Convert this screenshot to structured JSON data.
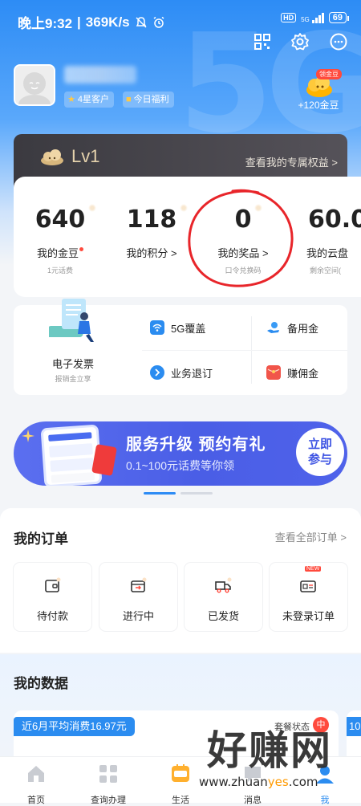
{
  "status_bar": {
    "time": "晚上9:32",
    "speed": "369K/s",
    "hd": "HD",
    "signal": "5G",
    "battery": "69"
  },
  "profile": {
    "tags": [
      "4星客户",
      "今日福利"
    ],
    "coin_badge": "领金豆",
    "coin_reward": "+120金豆"
  },
  "level": {
    "label": "Lv1",
    "link": "查看我的专属权益 >"
  },
  "stats": [
    {
      "value": "640",
      "label": "我的金豆",
      "sub": "1元话费"
    },
    {
      "value": "118",
      "label": "我的积分 >",
      "sub": ""
    },
    {
      "value": "0",
      "label": "我的奖品 >",
      "sub": "口令兑换码"
    },
    {
      "value": "60.0",
      "label": "我的云盘",
      "sub": "剩余空间("
    }
  ],
  "services": {
    "einvoice": {
      "label": "电子发票",
      "sub": "报销金立享"
    },
    "items": [
      {
        "label": "5G覆盖",
        "icon": "wifi-icon"
      },
      {
        "label": "备用金",
        "icon": "hand-coin-icon"
      },
      {
        "label": "业务退订",
        "icon": "arrow-circle-icon"
      },
      {
        "label": "赚佣金",
        "icon": "red-envelope-icon"
      }
    ]
  },
  "promo": {
    "title": "服务升级 预约有礼",
    "subtitle": "0.1~100元话费等你领",
    "button_line1": "立即",
    "button_line2": "参与"
  },
  "orders": {
    "title": "我的订单",
    "link": "查看全部订单 >",
    "new_badge": "NEW",
    "items": [
      "待付款",
      "进行中",
      "已发货",
      "未登录订单"
    ]
  },
  "my_data": {
    "title": "我的数据",
    "avg_tag": "近6月平均消费16.97元",
    "plan_label": "套餐状态",
    "plan_badge": "中",
    "peek_tag": "10"
  },
  "bottom_nav": {
    "items": [
      {
        "label": "首页",
        "icon": "home-icon",
        "active": false
      },
      {
        "label": "查询办理",
        "icon": "grid-icon",
        "active": false
      },
      {
        "label": "生活",
        "icon": "life-icon",
        "active": false
      },
      {
        "label": "消息",
        "icon": "message-icon",
        "active": false
      },
      {
        "label": "我",
        "icon": "me-icon",
        "active": true
      }
    ]
  },
  "watermark": {
    "text": "好赚网",
    "url_prefix": "www.zhuan",
    "url_highlight": "yes",
    "url_suffix": ".com"
  },
  "colors": {
    "brand_blue": "#2d8cf5",
    "level_gold": "#e6d3ad",
    "promo_blue": "#4a5ee6",
    "alert_red": "#ff4a3d"
  }
}
